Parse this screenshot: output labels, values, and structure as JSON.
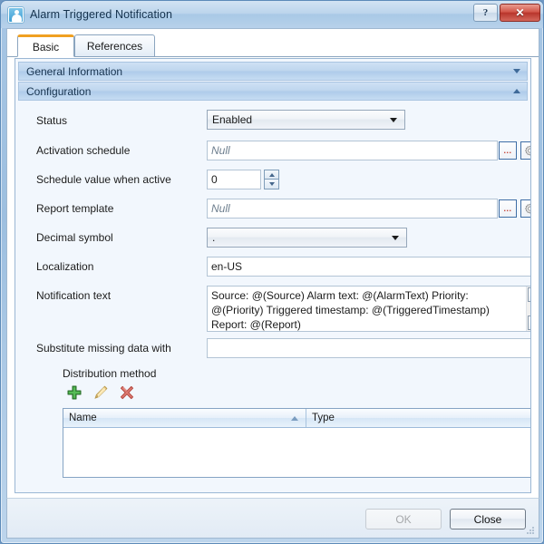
{
  "window": {
    "title": "Alarm Triggered Notification",
    "icon": "alarm-notification-icon",
    "help_label": "?",
    "close_label": "✕"
  },
  "tabs": [
    {
      "label": "Basic",
      "active": true
    },
    {
      "label": "References",
      "active": false
    }
  ],
  "sections": [
    {
      "label": "General Information",
      "state": "collapsed",
      "chevron": "chevron-down-icon"
    },
    {
      "label": "Configuration",
      "state": "expanded",
      "chevron": "chevron-up-icon"
    }
  ],
  "fields": {
    "status": {
      "label": "Status",
      "value": "Enabled",
      "type": "combobox"
    },
    "activation_schedule": {
      "label": "Activation schedule",
      "value": "",
      "placeholder": "Null",
      "type": "text",
      "browse_label": "...",
      "settings_icon": "gear-icon"
    },
    "schedule_value": {
      "label": "Schedule value when active",
      "value": "0",
      "type": "spinner"
    },
    "report_template": {
      "label": "Report template",
      "value": "",
      "placeholder": "Null",
      "type": "text",
      "browse_label": "...",
      "settings_icon": "gear-icon"
    },
    "decimal_symbol": {
      "label": "Decimal symbol",
      "value": ".",
      "type": "combobox"
    },
    "localization": {
      "label": "Localization",
      "value": "en-US",
      "type": "text"
    },
    "notification_text": {
      "label": "Notification text",
      "value": "Source: @(Source) Alarm text: @(AlarmText) Priority: @(Priority) Triggered timestamp: @(TriggeredTimestamp) Report: @(Report)",
      "type": "textarea"
    },
    "substitute_missing": {
      "label": "Substitute missing data with",
      "value": "",
      "type": "text"
    }
  },
  "distribution": {
    "label": "Distribution method",
    "toolbar": [
      {
        "name": "add-icon",
        "title": "Add",
        "color": "#3f9e3f"
      },
      {
        "name": "edit-icon",
        "title": "Edit",
        "color": "#e8c06a"
      },
      {
        "name": "delete-icon",
        "title": "Delete",
        "color": "#d96a62"
      }
    ],
    "columns": [
      {
        "label": "Name",
        "sort": "ascending"
      },
      {
        "label": "Type",
        "sort": "none"
      }
    ],
    "rows": []
  },
  "footer": {
    "ok_label": "OK",
    "ok_enabled": false,
    "close_label": "Close",
    "close_enabled": true
  },
  "colors": {
    "accent_tab": "#f0a022",
    "section_header": "#bdd5ee",
    "close_button": "#b8352c",
    "window_chrome": "#a7c6e4"
  }
}
